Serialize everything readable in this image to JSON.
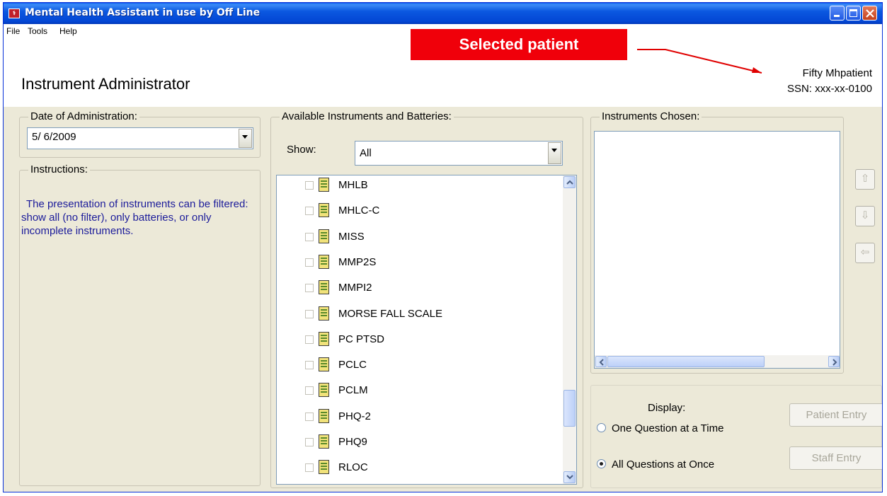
{
  "window": {
    "title": "Mental Health Assistant in use by Off Line",
    "icon": "mha-app-icon",
    "controls": [
      "minimize-icon",
      "maximize-icon",
      "close-icon"
    ]
  },
  "menu": {
    "file": "File",
    "tools": "Tools",
    "help": "Help"
  },
  "header": {
    "page_title": "Instrument Administrator",
    "callout_label": "Selected patient",
    "patient_name": "Fifty Mhpatient",
    "patient_ssn": "SSN: xxx-xx-0100"
  },
  "date_group": {
    "legend": "Date of Administration:",
    "value": "5/ 6/2009"
  },
  "instructions": {
    "legend": "Instructions:",
    "text": "The presentation of instruments can be filtered: show all (no filter), only batteries, or only incomplete instruments."
  },
  "available": {
    "legend": "Available Instruments and Batteries:",
    "show_label": "Show:",
    "show_value": "All",
    "items": [
      "MHLB",
      "MHLC-C",
      "MISS",
      "MMP2S",
      "MMPI2",
      "MORSE FALL SCALE",
      "PC PTSD",
      "PCLC",
      "PCLM",
      "PHQ-2",
      "PHQ9",
      "RLOC"
    ],
    "scroll_position_fraction": 0.82
  },
  "chosen": {
    "legend": "Instruments Chosen:",
    "move_up": "⇧",
    "move_down": "⇩",
    "remove": "⇦"
  },
  "display": {
    "label": "Display:",
    "option_one": "One Question at a Time",
    "option_all": "All Questions at Once",
    "selected": "All Questions at Once"
  },
  "buttons": {
    "patient_entry": "Patient Entry",
    "staff_entry": "Staff Entry"
  },
  "colors": {
    "callout": "#f0000a",
    "titlebar": "#0346d4",
    "instruction_text": "#1b1b9a",
    "window_bg": "#ece9d8"
  }
}
